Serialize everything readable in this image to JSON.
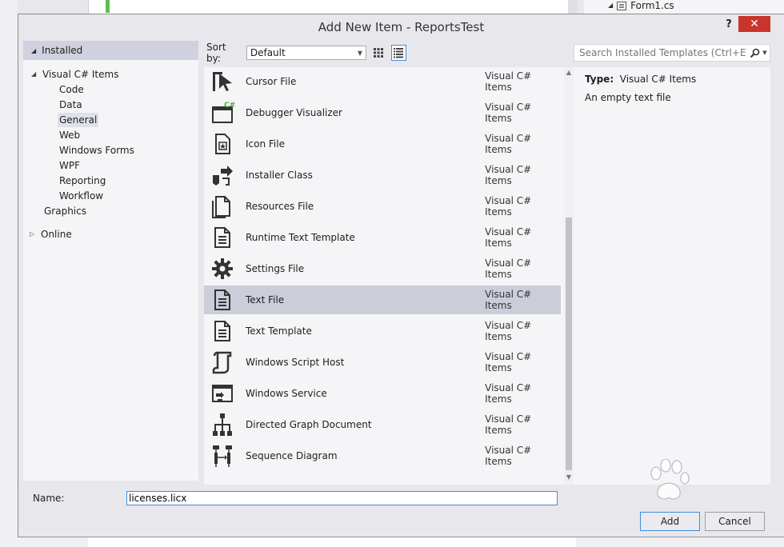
{
  "background": {
    "solution_item": "Form1.cs"
  },
  "dialog": {
    "title": "Add New Item - ReportsTest",
    "help_glyph": "?",
    "close_glyph": "✕"
  },
  "tree": {
    "installed": "Installed",
    "visual_csharp": "Visual C# Items",
    "children": [
      "Code",
      "Data",
      "General",
      "Web",
      "Windows Forms",
      "WPF",
      "Reporting",
      "Workflow"
    ],
    "graphics": "Graphics",
    "online": "Online",
    "selected": "General"
  },
  "sort": {
    "label": "Sort by:",
    "value": "Default"
  },
  "search": {
    "placeholder": "Search Installed Templates (Ctrl+E)"
  },
  "templates": [
    {
      "name": "Cursor File",
      "category": "Visual C# Items",
      "icon": "cursor-file-icon"
    },
    {
      "name": "Debugger Visualizer",
      "category": "Visual C# Items",
      "icon": "debugger-visualizer-icon"
    },
    {
      "name": "Icon File",
      "category": "Visual C# Items",
      "icon": "icon-file-icon"
    },
    {
      "name": "Installer Class",
      "category": "Visual C# Items",
      "icon": "installer-class-icon"
    },
    {
      "name": "Resources File",
      "category": "Visual C# Items",
      "icon": "resources-file-icon"
    },
    {
      "name": "Runtime Text Template",
      "category": "Visual C# Items",
      "icon": "runtime-text-template-icon"
    },
    {
      "name": "Settings File",
      "category": "Visual C# Items",
      "icon": "settings-file-icon"
    },
    {
      "name": "Text File",
      "category": "Visual C# Items",
      "icon": "text-file-icon"
    },
    {
      "name": "Text Template",
      "category": "Visual C# Items",
      "icon": "text-template-icon"
    },
    {
      "name": "Windows Script Host",
      "category": "Visual C# Items",
      "icon": "windows-script-host-icon"
    },
    {
      "name": "Windows Service",
      "category": "Visual C# Items",
      "icon": "windows-service-icon"
    },
    {
      "name": "Directed Graph Document",
      "category": "Visual C# Items",
      "icon": "directed-graph-icon"
    },
    {
      "name": "Sequence Diagram",
      "category": "Visual C# Items",
      "icon": "sequence-diagram-icon"
    }
  ],
  "selected_template": "Text File",
  "details": {
    "type_label": "Type:",
    "type_value": "Visual C# Items",
    "description": "An empty text file"
  },
  "name_field": {
    "label": "Name:",
    "value": "licenses.licx"
  },
  "buttons": {
    "add": "Add",
    "cancel": "Cancel"
  },
  "colors": {
    "selection": "#cbcdd8",
    "accent": "#3d8ee0",
    "close": "#c7352d"
  }
}
